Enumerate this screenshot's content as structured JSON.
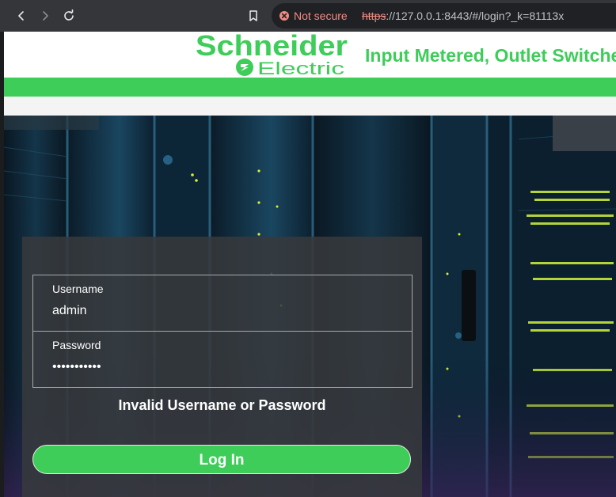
{
  "browser": {
    "security_text": "Not secure",
    "url_scheme": "https",
    "url_rest": "://127.0.0.1:8443/#/login?_k=81113x",
    "icons": [
      "back-icon",
      "forward-icon",
      "reload-icon",
      "bookmark-icon",
      "not-secure-icon"
    ]
  },
  "header": {
    "logo_text": "Schneider",
    "logo_subtext": "Electric",
    "product_title": "Input Metered, Outlet Switched"
  },
  "login": {
    "username_label": "Username",
    "username_value": "admin",
    "password_label": "Password",
    "password_value": "•••••••••••",
    "error_message": "Invalid Username or Password",
    "login_button": "Log In"
  },
  "colors": {
    "brand_green": "#3dcd58",
    "not_secure_red": "#f28b82",
    "panel_bg": "#37393c"
  }
}
